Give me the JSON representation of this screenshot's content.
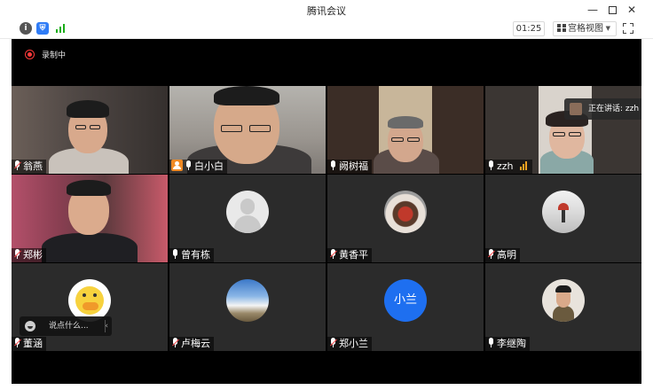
{
  "window": {
    "title": "腾讯会议"
  },
  "toolbar": {
    "timer": "01:25",
    "view_mode": "宫格视图"
  },
  "recording": {
    "label": "录制中"
  },
  "speaking": {
    "text": "正在讲话: zzh"
  },
  "chat": {
    "placeholder": "说点什么..."
  },
  "participants": [
    {
      "name": "翁燕",
      "mic": "muted",
      "kind": "video"
    },
    {
      "name": "白小白",
      "mic": "on",
      "kind": "video",
      "host": true
    },
    {
      "name": "阙树福",
      "mic": "on",
      "kind": "video"
    },
    {
      "name": "zzh",
      "mic": "on",
      "kind": "video",
      "speaking": true
    },
    {
      "name": "郑彬",
      "mic": "muted",
      "kind": "video"
    },
    {
      "name": "曾有栋",
      "mic": "on",
      "kind": "avatar-default"
    },
    {
      "name": "黄香平",
      "mic": "muted",
      "kind": "avatar-photo"
    },
    {
      "name": "高明",
      "mic": "muted",
      "kind": "avatar-photo"
    },
    {
      "name": "董涵",
      "mic": "muted",
      "kind": "avatar-photo"
    },
    {
      "name": "卢梅云",
      "mic": "muted",
      "kind": "avatar-photo"
    },
    {
      "name": "郑小兰",
      "mic": "muted",
      "kind": "avatar-text",
      "avatar_text": "小兰"
    },
    {
      "name": "李继陶",
      "mic": "on",
      "kind": "avatar-photo"
    }
  ],
  "colors": {
    "stage_bg": "#000000",
    "tile_bg": "#2b2b2b",
    "record_red": "#ff3a3a",
    "host_orange": "#f08a24",
    "avatar_blue": "#1e6ff0",
    "signal_green": "#1aad19"
  },
  "icons": {
    "info": "info-icon",
    "security": "shield-icon",
    "network": "signal-icon",
    "grid": "grid-view-icon",
    "fullscreen": "fullscreen-icon",
    "record": "record-icon",
    "mic": "mic-icon",
    "mic_muted": "mic-muted-icon",
    "emoji": "emoji-icon"
  }
}
